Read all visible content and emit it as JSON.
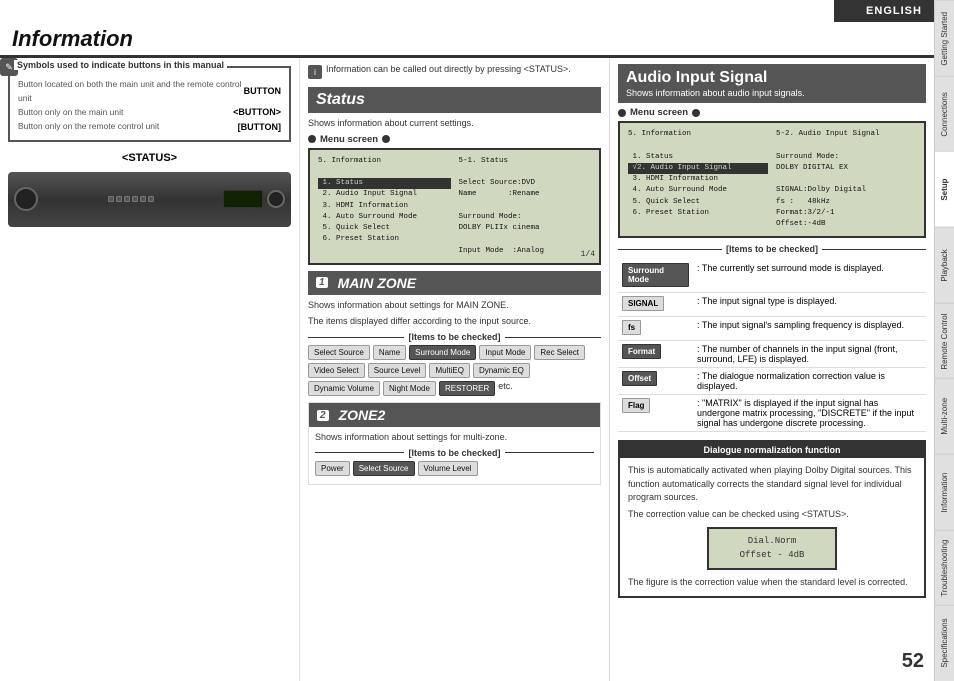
{
  "page": {
    "title": "Information",
    "page_number": "52",
    "language": "ENGLISH"
  },
  "sidebar": {
    "tabs": [
      {
        "label": "Getting Started",
        "active": false
      },
      {
        "label": "Connections",
        "active": false
      },
      {
        "label": "Setup",
        "active": true
      },
      {
        "label": "Playback",
        "active": false
      },
      {
        "label": "Remote Control",
        "active": false
      },
      {
        "label": "Multi-zone",
        "active": false
      },
      {
        "label": "Information",
        "active": false
      },
      {
        "label": "Troubleshooting",
        "active": false
      },
      {
        "label": "Specifications",
        "active": false
      }
    ]
  },
  "symbols_box": {
    "title": "Symbols used to indicate buttons in this manual",
    "lines": [
      "Button located on both the main unit and the remote control unit",
      "Button only on the main unit",
      "Button only on the remote control unit"
    ],
    "labels": [
      "BUTTON",
      "<BUTTON>",
      "[BUTTON]"
    ]
  },
  "status_section": {
    "label": "<STATUS>",
    "title": "Status",
    "subtitle": "Shows information about current settings.",
    "menu_screen_label": "Menu screen",
    "menu_screen_content": [
      "5. Information",
      "",
      "1. Status",
      "2. Audio Input Signal",
      "3. HDMI Information",
      "4. Auto Surround Mode",
      "5. Quick Select",
      "6. Preset Station"
    ],
    "submenu_content": [
      "5-1. Status",
      "",
      "Select Source:DVD",
      "Name       :Rename",
      "",
      "Surround Mode:",
      "DOLBY PLIIx cinema",
      "",
      "Input Mode  :Analog"
    ],
    "page_indicator": "1/4"
  },
  "main_zone": {
    "number": "1",
    "title": "MAIN ZONE",
    "subtitle1": "Shows information about settings for MAIN ZONE.",
    "subtitle2": "The items displayed differ according to the input source.",
    "items_label": "[Items to be checked]",
    "buttons": [
      "Select Source",
      "Name",
      "Surround Mode",
      "Input Mode",
      "Rec Select",
      "Video Select",
      "Source Level",
      "MultiEQ",
      "Dynamic EQ",
      "Dynamic Volume",
      "Night Mode",
      "RESTORER"
    ],
    "etc": "etc."
  },
  "zone2": {
    "number": "2",
    "title": "ZONE2",
    "subtitle": "Shows information about settings for multi-zone.",
    "items_label": "[Items to be checked]",
    "buttons": [
      "Power",
      "Select Source",
      "Volume Level"
    ]
  },
  "audio_input_signal": {
    "title": "Audio Input Signal",
    "subtitle": "Shows information about audio input signals.",
    "menu_screen_label": "Menu screen",
    "screen_content": [
      "5. Information",
      "",
      "1. Status",
      "√2. Audio Input Signal",
      "3. HDMI Information",
      "4. Auto Surround Mode",
      "5. Quick Select",
      "6. Preset Station"
    ],
    "sub_screen": [
      "5-2. Audio Input Signal",
      "",
      "Surround Mode:",
      "DOLBY DIGITAL EX",
      "",
      "SIGNAL:Dolby Digital",
      "fs :   48kHz",
      "Format:3/2/-1",
      "Offset:-4dB"
    ],
    "items_label": "[Items to be checked]",
    "items": [
      {
        "key": "Surround Mode",
        "key_style": "dark",
        "description": ": The currently set surround mode is displayed."
      },
      {
        "key": "SIGNAL",
        "key_style": "normal",
        "description": ": The input signal type is displayed."
      },
      {
        "key": "fs",
        "key_style": "normal",
        "description": ": The input signal's sampling frequency is displayed."
      },
      {
        "key": "Format",
        "key_style": "dark",
        "description": ": The number of channels in the input signal (front, surround, LFE) is displayed."
      },
      {
        "key": "Offset",
        "key_style": "dark",
        "description": ": The dialogue normalization correction value is displayed."
      },
      {
        "key": "Flag",
        "key_style": "normal",
        "description": ": \"MATRIX\" is displayed if the input signal has undergone matrix processing, \"DISCRETE\" if the input signal has undergone discrete processing."
      }
    ]
  },
  "dialogue_normalization": {
    "title": "Dialogue normalization function",
    "content1": "This is automatically activated when playing Dolby Digital sources. This function automatically corrects the standard signal level for individual program sources.",
    "content2": "The correction value can be checked using <STATUS>.",
    "screen_line1": "Dial.Norm",
    "screen_line2": "Offset  -  4dB",
    "footer": "The figure is the correction value when the standard level is corrected."
  },
  "info_note": {
    "text": "Information can be called out directly by pressing <STATUS>."
  }
}
